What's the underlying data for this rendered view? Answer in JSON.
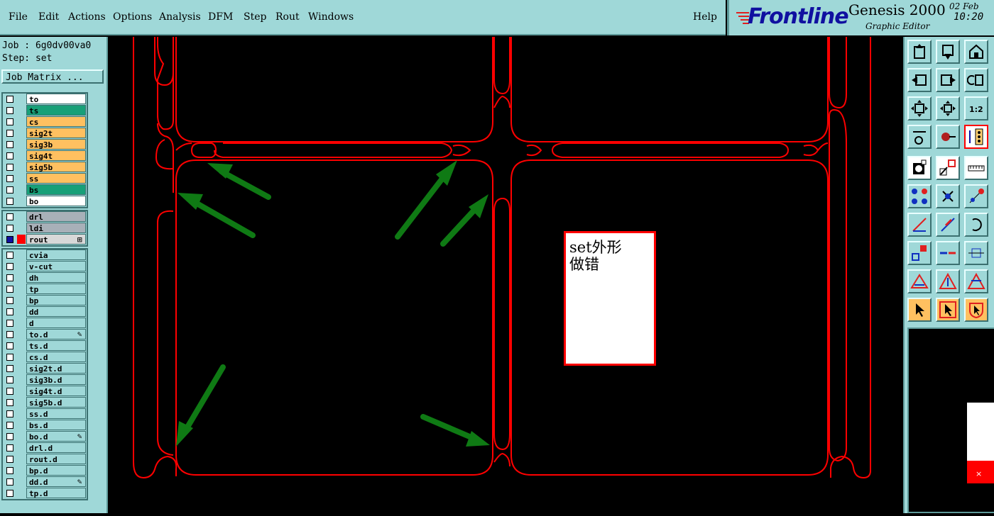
{
  "menu": {
    "items": [
      "File",
      "Edit",
      "Actions",
      "Options",
      "Analysis",
      "DFM",
      "Step",
      "Rout",
      "Windows"
    ],
    "help": "Help"
  },
  "branding": {
    "logo": "Frontline",
    "app_title": "Genesis 2000",
    "app_subtitle": "Graphic Editor",
    "date": "02 Feb",
    "time": "10:20"
  },
  "job": {
    "job_line": "Job : 6g0dv00va0",
    "step_line": "Step: set",
    "matrix_button": "Job Matrix ..."
  },
  "layers": {
    "board": [
      {
        "name": "to",
        "color": "#ffffff"
      },
      {
        "name": "ts",
        "color": "#18a078"
      },
      {
        "name": "cs",
        "color": "#ffc060"
      },
      {
        "name": "sig2t",
        "color": "#ffc060"
      },
      {
        "name": "sig3b",
        "color": "#ffc060"
      },
      {
        "name": "sig4t",
        "color": "#ffc060"
      },
      {
        "name": "sig5b",
        "color": "#ffc060"
      },
      {
        "name": "ss",
        "color": "#ffc060"
      },
      {
        "name": "bs",
        "color": "#18a078"
      },
      {
        "name": "bo",
        "color": "#ffffff"
      }
    ],
    "drill": [
      {
        "name": "drl",
        "color": "#a8b0b8"
      },
      {
        "name": "ldi",
        "color": "#a8b0b8"
      },
      {
        "name": "rout",
        "color": "#d8d8d8",
        "selected": true,
        "mark": "⊞"
      }
    ],
    "misc": [
      {
        "name": "cvia",
        "color": "#9fd8d8"
      },
      {
        "name": "v-cut",
        "color": "#9fd8d8"
      },
      {
        "name": "dh",
        "color": "#9fd8d8"
      },
      {
        "name": "tp",
        "color": "#9fd8d8"
      },
      {
        "name": "bp",
        "color": "#9fd8d8"
      },
      {
        "name": "dd",
        "color": "#9fd8d8"
      },
      {
        "name": "d",
        "color": "#9fd8d8"
      },
      {
        "name": "to.d",
        "color": "#9fd8d8",
        "mark": "✎"
      },
      {
        "name": "ts.d",
        "color": "#9fd8d8"
      },
      {
        "name": "cs.d",
        "color": "#9fd8d8"
      },
      {
        "name": "sig2t.d",
        "color": "#9fd8d8"
      },
      {
        "name": "sig3b.d",
        "color": "#9fd8d8"
      },
      {
        "name": "sig4t.d",
        "color": "#9fd8d8"
      },
      {
        "name": "sig5b.d",
        "color": "#9fd8d8"
      },
      {
        "name": "ss.d",
        "color": "#9fd8d8"
      },
      {
        "name": "bs.d",
        "color": "#9fd8d8"
      },
      {
        "name": "bo.d",
        "color": "#9fd8d8",
        "mark": "✎"
      },
      {
        "name": "drl.d",
        "color": "#9fd8d8"
      },
      {
        "name": "rout.d",
        "color": "#9fd8d8"
      },
      {
        "name": "bp.d",
        "color": "#9fd8d8"
      },
      {
        "name": "dd.d",
        "color": "#9fd8d8",
        "mark": "✎"
      },
      {
        "name": "tp.d",
        "color": "#9fd8d8"
      }
    ]
  },
  "annotation": {
    "note_line1": "set外形",
    "note_line2": "做错"
  },
  "colors": {
    "profile": "#ff0000",
    "arrow": "#0f7a14",
    "panel": "#9fd8d8"
  }
}
